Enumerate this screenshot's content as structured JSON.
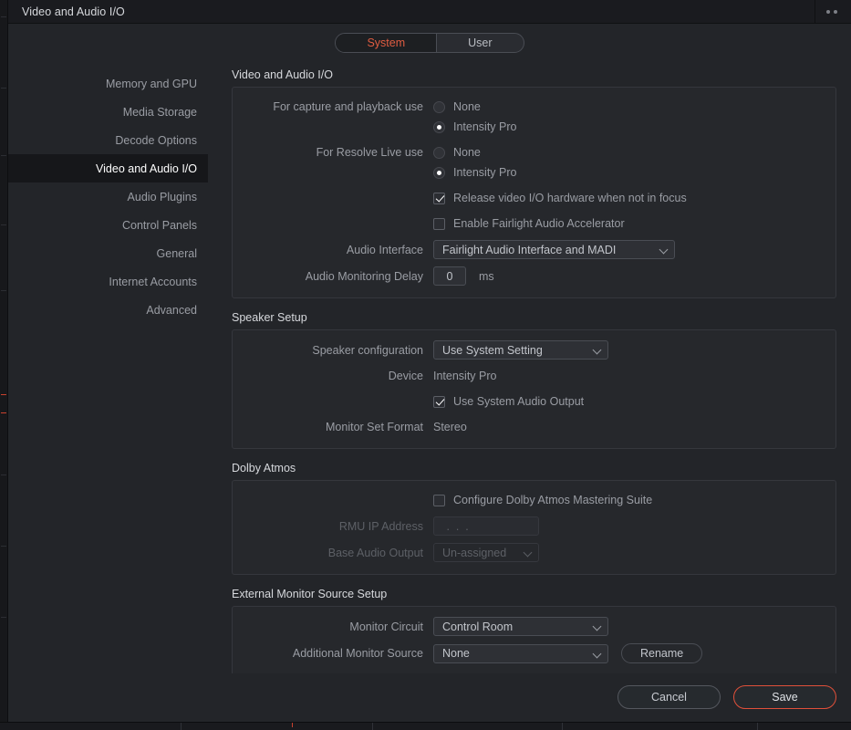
{
  "window": {
    "title": "Video and Audio I/O",
    "menu_icon": "more-dots-icon"
  },
  "scope_toggle": {
    "options": [
      "System",
      "User"
    ],
    "active": "System"
  },
  "sidebar": {
    "items": [
      {
        "label": "Memory and GPU",
        "active": false
      },
      {
        "label": "Media Storage",
        "active": false
      },
      {
        "label": "Decode Options",
        "active": false
      },
      {
        "label": "Video and Audio I/O",
        "active": true
      },
      {
        "label": "Audio Plugins",
        "active": false
      },
      {
        "label": "Control Panels",
        "active": false
      },
      {
        "label": "General",
        "active": false
      },
      {
        "label": "Internet Accounts",
        "active": false
      },
      {
        "label": "Advanced",
        "active": false
      }
    ]
  },
  "sections": {
    "video_audio_io": {
      "title": "Video and Audio I/O",
      "capture_playback": {
        "label": "For capture and playback use",
        "options": [
          "None",
          "Intensity Pro"
        ],
        "selected": "Intensity Pro"
      },
      "resolve_live": {
        "label": "For Resolve Live use",
        "options": [
          "None",
          "Intensity Pro"
        ],
        "selected": "Intensity Pro"
      },
      "release_hardware": {
        "label": "Release video I/O hardware when not in focus",
        "checked": true
      },
      "fairlight_accelerator": {
        "label": "Enable Fairlight Audio Accelerator",
        "checked": false
      },
      "audio_interface": {
        "label": "Audio Interface",
        "value": "Fairlight Audio Interface and MADI"
      },
      "monitoring_delay": {
        "label": "Audio Monitoring Delay",
        "value": "0",
        "unit": "ms"
      }
    },
    "speaker_setup": {
      "title": "Speaker Setup",
      "speaker_configuration": {
        "label": "Speaker configuration",
        "value": "Use System Setting"
      },
      "device": {
        "label": "Device",
        "value": "Intensity Pro"
      },
      "use_system_audio_output": {
        "label": "Use System Audio Output",
        "checked": true
      },
      "monitor_set_format": {
        "label": "Monitor Set Format",
        "value": "Stereo"
      }
    },
    "dolby_atmos": {
      "title": "Dolby Atmos",
      "configure_suite": {
        "label": "Configure Dolby Atmos Mastering Suite",
        "checked": false
      },
      "rmu_ip_address": {
        "label": "RMU IP Address",
        "value": "",
        "placeholder": " .  .  . "
      },
      "base_audio_output": {
        "label": "Base Audio Output",
        "value": "Un-assigned"
      }
    },
    "external_monitor": {
      "title": "External Monitor Source Setup",
      "monitor_circuit": {
        "label": "Monitor Circuit",
        "value": "Control Room"
      },
      "additional_monitor_source": {
        "label": "Additional Monitor Source",
        "value": "None",
        "rename_label": "Rename"
      }
    }
  },
  "footer": {
    "cancel_label": "Cancel",
    "save_label": "Save"
  },
  "colors": {
    "accent": "#e0503a",
    "window_bg": "#232529",
    "panel_bg": "#26282c",
    "title_bg": "#1a1b1f"
  }
}
